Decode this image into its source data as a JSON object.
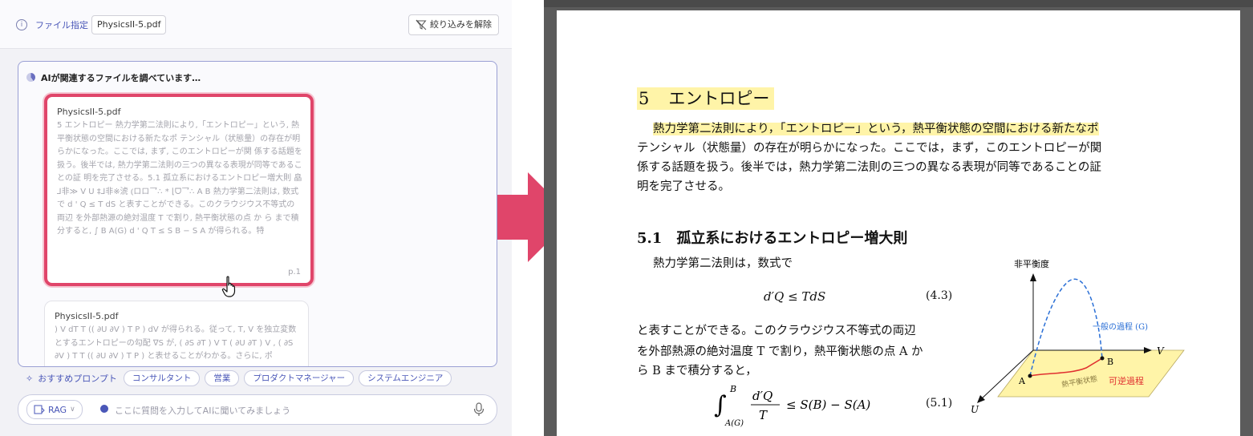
{
  "header": {
    "file_label": "ファイル指定",
    "file_name": "PhysicsII-5.pdf",
    "clear_filter_label": "絞り込みを解除"
  },
  "chat": {
    "status": "AIが関連するファイルを調べています…",
    "results": [
      {
        "title": "PhysicsII-5.pdf",
        "snippet": "5 エントロピー 熱力学第二法則により,「エントロピー」という, 熱平衡状態の空間における新たなポ テンシャル（状態量）の存在が明らかになった。ここでは, まず, このエントロピーが関 係する話題を扱う。後半では, 熱力学第二法則の三つの異なる表現が同等であることの証 明を完了させる。5.1 孤立系におけるエントロピー増大則 皛⅃非≫ V U ‡⅃非※淲 ⦅ロロ乛∴ * ⌊ᗜ乛∴ A B 熱力学第二法則は, 数式で d ' Q ≤ T dS と表すことができる。このクラウジウス不等式の両辺 を外部熱源の絶対温度 T で割り, 熱平衡状態の点 か ら まで積分すると, ∫ B A(G) d ' Q T ≤ S B − S A が得られる。特",
        "page": "p.1"
      },
      {
        "title": "PhysicsII-5.pdf",
        "snippet": ") V dT T (( ∂U ∂V ) T P ) dV が得られる。従って, T, V を独立変数とするエントロピーの勾配 ∇S が, ( ∂S ∂T ) V T ( ∂U ∂T ) V , ( ∂S ∂V ) T T (( ∂U ∂V ) T P ) と表せることがわかる。さらに, ポ",
        "page": ""
      }
    ]
  },
  "prompts": {
    "label": "おすすめプロンプト",
    "chips": [
      "コンサルタント",
      "営業",
      "プロダクトマネージャー",
      "システムエンジニア"
    ]
  },
  "input": {
    "mode": "RAG",
    "placeholder": "ここに質問を入力してAIに聞いてみましょう"
  },
  "colors": {
    "accent": "#4a57b8",
    "highlight_border": "#e0456a",
    "arrow": "#e0456a",
    "pdf_highlight": "#fff4a8"
  },
  "document": {
    "section_number": "5",
    "section_title": "エントロピー",
    "para_highlighted": "熱力学第二法則により，「エントロピー」という，熱平衡状態の空間における新たなポ",
    "para_line2": "テンシャル（状態量）の存在が明らかになった。ここでは，まず，このエントロピーが関",
    "para_line3": "係する話題を扱う。後半では，熱力学第二法則の三つの異なる表現が同等であることの証",
    "para_line4": "明を完了させる。",
    "subsection_number": "5.1",
    "subsection_title": "孤立系におけるエントロピー増大則",
    "body1": "熱力学第二法則は，数式で",
    "eq1": "d′Q ≤ TdS",
    "eq1_number": "(4.3)",
    "body2": "と表すことができる。このクラウジウス不等式の両辺",
    "body3": "を外部熱源の絶対温度 T で割り，熱平衡状態の点 A か",
    "body4": "ら B まで積分すると，",
    "eq2_number": "(5.1)",
    "diagram": {
      "y_label": "非平衡度",
      "v_label": "V",
      "u_label": "U",
      "a_label": "A",
      "b_label": "B",
      "general_process": "一般の過程 (G)",
      "reversible_process": "可逆過程",
      "plane_label": "熱平衡状態"
    }
  }
}
